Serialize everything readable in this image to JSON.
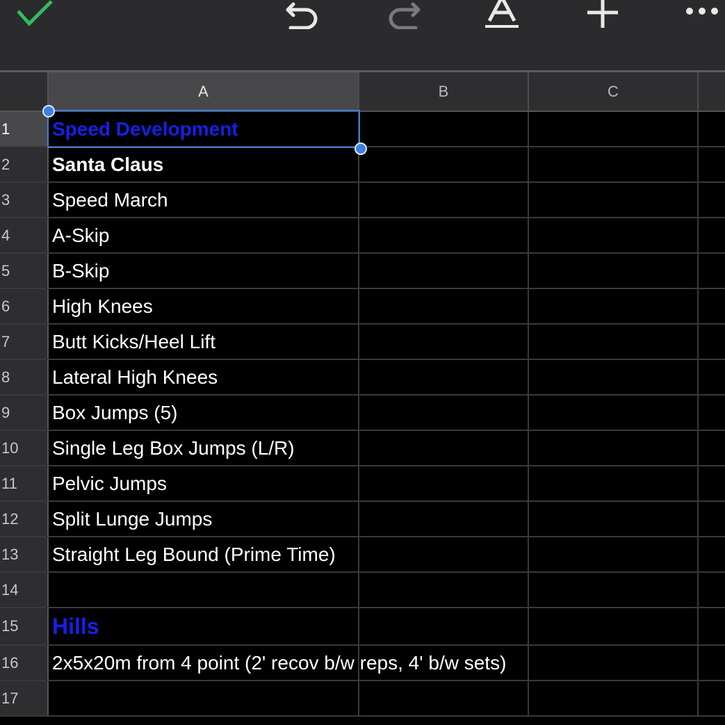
{
  "toolbar": {
    "icons": [
      "check-icon",
      "undo-icon",
      "redo-icon",
      "text-format-icon",
      "add-icon",
      "more-icon"
    ],
    "accent_check": "#2fbf5b"
  },
  "columns": [
    "A",
    "B",
    "C"
  ],
  "selected_cell": "A1",
  "rows": [
    {
      "num": "1",
      "text": "Speed Development",
      "style": "blue"
    },
    {
      "num": "2",
      "text": "Santa Claus",
      "style": "bold"
    },
    {
      "num": "3",
      "text": "Speed March",
      "style": "normal"
    },
    {
      "num": "4",
      "text": "A-Skip",
      "style": "normal"
    },
    {
      "num": "5",
      "text": "B-Skip",
      "style": "normal"
    },
    {
      "num": "6",
      "text": "High Knees",
      "style": "normal"
    },
    {
      "num": "7",
      "text": "Butt Kicks/Heel Lift",
      "style": "normal"
    },
    {
      "num": "8",
      "text": "Lateral High Knees",
      "style": "normal"
    },
    {
      "num": "9",
      "text": "Box Jumps (5)",
      "style": "normal"
    },
    {
      "num": "10",
      "text": "Single Leg Box Jumps (L/R)",
      "style": "normal"
    },
    {
      "num": "11",
      "text": "Pelvic Jumps",
      "style": "normal"
    },
    {
      "num": "12",
      "text": "Split Lunge Jumps",
      "style": "normal"
    },
    {
      "num": "13",
      "text": "Straight Leg Bound (Prime Time)",
      "style": "normal"
    },
    {
      "num": "14",
      "text": "",
      "style": "normal"
    },
    {
      "num": "15",
      "text": "Hills",
      "style": "blue-big"
    },
    {
      "num": "16",
      "text": "2x5x20m from 4 point (2' recov b/w reps, 4' b/w sets)",
      "style": "normal"
    },
    {
      "num": "17",
      "text": "",
      "style": "normal"
    }
  ],
  "colors": {
    "selection": "#3f7fe0",
    "heading_text": "#1620e6"
  }
}
